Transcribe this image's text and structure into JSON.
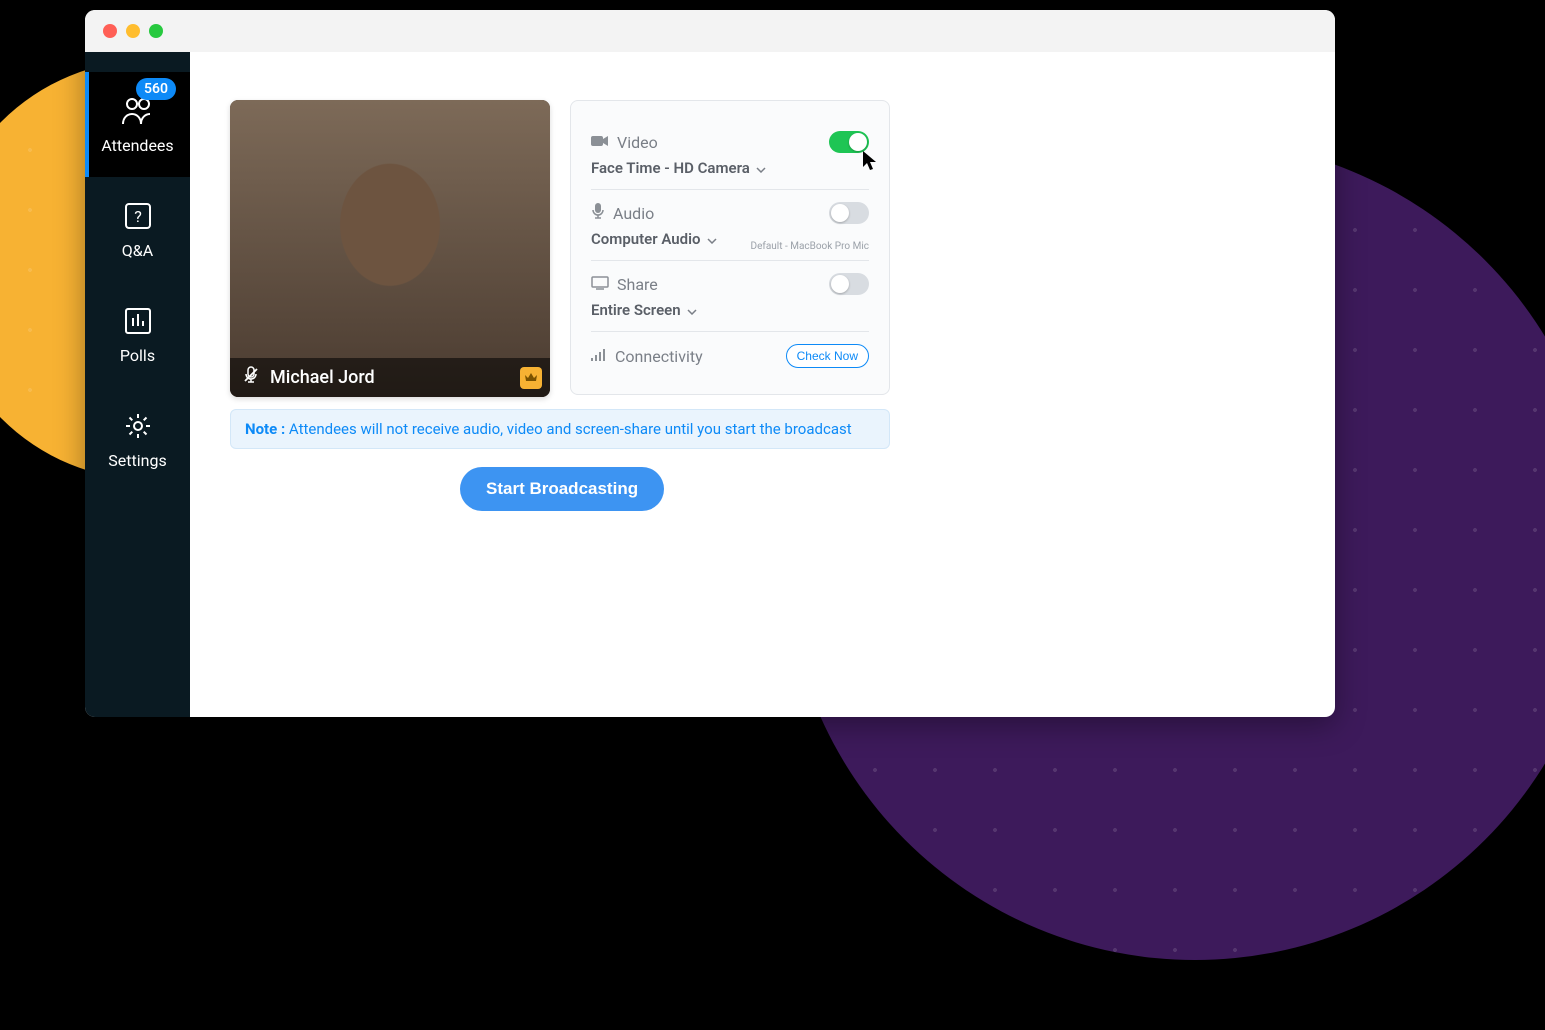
{
  "sidebar": {
    "items": [
      {
        "label": "Attendees",
        "badge": "560"
      },
      {
        "label": "Q&A"
      },
      {
        "label": "Polls"
      },
      {
        "label": "Settings"
      }
    ]
  },
  "video_tile": {
    "presenter_name": "Michael Jord"
  },
  "settings": {
    "video": {
      "label": "Video",
      "selected": "Face Time - HD Camera",
      "enabled": true
    },
    "audio": {
      "label": "Audio",
      "selected": "Computer Audio",
      "meta": "Default - MacBook Pro Mic",
      "enabled": false
    },
    "share": {
      "label": "Share",
      "selected": "Entire Screen",
      "enabled": false
    },
    "connectivity": {
      "label": "Connectivity",
      "button": "Check Now"
    }
  },
  "note": {
    "label": "Note :",
    "text": " Attendees will not receive audio, video and screen-share until you start the broadcast"
  },
  "actions": {
    "start_broadcast": "Start Broadcasting"
  }
}
